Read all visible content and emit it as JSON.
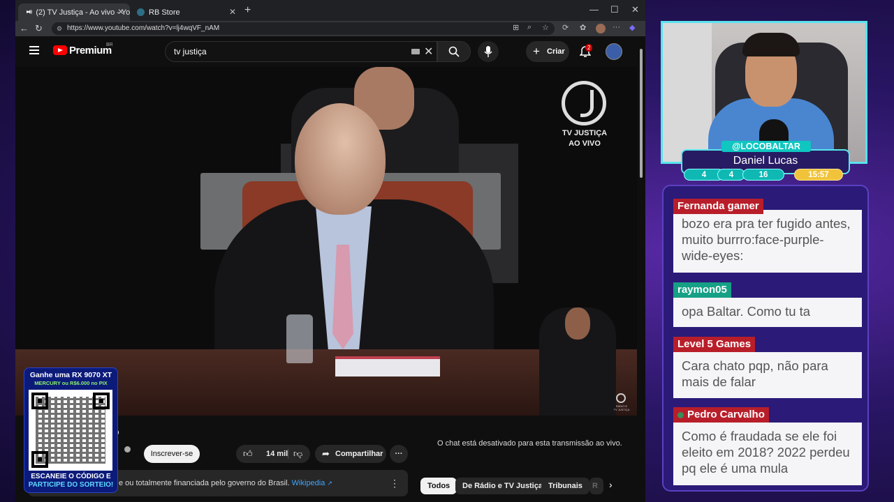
{
  "browser": {
    "active_tab_title": "(2) TV Justiça - Ao vivo - You",
    "second_tab_title": "RB Store",
    "url": "https://www.youtube.com/watch?v=lj4wqVF_nAM"
  },
  "youtube": {
    "logo_text": "Premium",
    "region": "BR",
    "search_query": "tv justiça",
    "create_label": "Criar",
    "notification_count": "2"
  },
  "video": {
    "watermark_line1": "TV JUSTIÇA",
    "watermark_line2": "AO VIVO",
    "corner_line1": "RÁDIO E",
    "corner_line2": "TV JUSTIÇA",
    "title_fragment": "o",
    "channel_fragment": "a"
  },
  "actions": {
    "subscribe_label": "Inscrever-se",
    "likes": "14 mil",
    "share_label": "Compartilhar"
  },
  "description": {
    "text": "e ou totalmente financiada pelo governo do Brasil.",
    "link": "Wikipedia"
  },
  "chat_disabled": "O chat está desativado para esta transmissão ao vivo.",
  "chips": [
    "Todos",
    "De Rádio e TV Justiça",
    "Tribunais",
    "R"
  ],
  "qr_promo": {
    "headline": "Ganhe uma RX 9070 XT",
    "subline": "MERCURY ou R$6.000 no PIX",
    "cta1": "ESCANEIE O CÓDIGO E",
    "cta2": "PARTICIPE DO SORTEIO!"
  },
  "stream_overlay": {
    "handle": "@LOCOBALTAR",
    "name": "Daniel Lucas",
    "stats": [
      "4",
      "4",
      "16"
    ],
    "time": "15:57"
  },
  "chat": [
    {
      "user": "Fernanda gamer",
      "text": "bozo era pra ter fugido antes, muito burrro:face-purple-wide-eyes:",
      "color": "#b81e2a"
    },
    {
      "user": "raymon05",
      "text": "opa Baltar. Como tu ta",
      "color": "#16a085"
    },
    {
      "user": "Level 5 Games",
      "text": "Cara chato pqp, não para mais de falar",
      "color": "#b81e2a"
    },
    {
      "user": "Pedro Carvalho",
      "text": "Como é fraudada se ele foi eleito em 2018? 2022 perdeu pq ele é uma mula",
      "color": "#b81e2a"
    }
  ]
}
